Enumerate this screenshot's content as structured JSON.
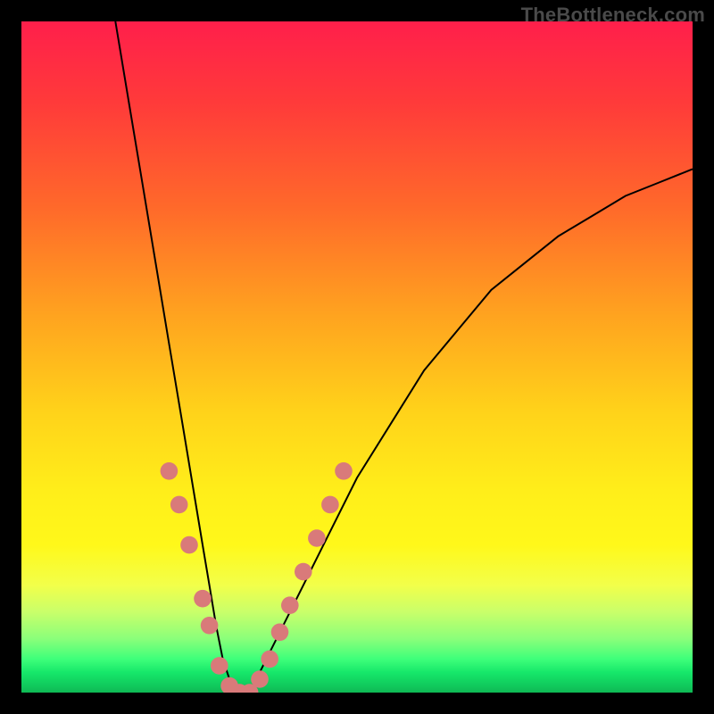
{
  "watermark": "TheBottleneck.com",
  "colors": {
    "frame": "#000000",
    "curve": "#000000",
    "dot": "#d97a7a",
    "gradient_top": "#ff1f4b",
    "gradient_bottom": "#10c95c"
  },
  "chart_data": {
    "type": "line",
    "title": "",
    "subtitle": "",
    "xlabel": "",
    "ylabel": "",
    "xlim": [
      0,
      100
    ],
    "ylim": [
      0,
      100
    ],
    "grid": false,
    "legend": false,
    "series": [
      {
        "name": "curve",
        "x": [
          14,
          16,
          18,
          20,
          22,
          24,
          25,
          26,
          27,
          28,
          29,
          30,
          31,
          32,
          33,
          34,
          35,
          37,
          40,
          45,
          50,
          55,
          60,
          65,
          70,
          75,
          80,
          85,
          90,
          95,
          100
        ],
        "y": [
          100,
          88,
          76,
          64,
          52,
          40,
          34,
          28,
          22,
          16,
          10,
          5,
          2,
          0,
          0,
          0,
          2,
          6,
          12,
          22,
          32,
          40,
          48,
          54,
          60,
          64,
          68,
          71,
          74,
          76,
          78
        ]
      }
    ],
    "markers": {
      "color": "#d97a7a",
      "radius_pct": 1.3,
      "points": [
        {
          "x": 22.0,
          "y": 33.0
        },
        {
          "x": 23.5,
          "y": 28.0
        },
        {
          "x": 25.0,
          "y": 22.0
        },
        {
          "x": 27.0,
          "y": 14.0
        },
        {
          "x": 28.0,
          "y": 10.0
        },
        {
          "x": 29.5,
          "y": 4.0
        },
        {
          "x": 31.0,
          "y": 1.0
        },
        {
          "x": 32.5,
          "y": 0.0
        },
        {
          "x": 34.0,
          "y": 0.0
        },
        {
          "x": 35.5,
          "y": 2.0
        },
        {
          "x": 37.0,
          "y": 5.0
        },
        {
          "x": 38.5,
          "y": 9.0
        },
        {
          "x": 40.0,
          "y": 13.0
        },
        {
          "x": 42.0,
          "y": 18.0
        },
        {
          "x": 44.0,
          "y": 23.0
        },
        {
          "x": 46.0,
          "y": 28.0
        },
        {
          "x": 48.0,
          "y": 33.0
        }
      ]
    },
    "annotations": []
  }
}
